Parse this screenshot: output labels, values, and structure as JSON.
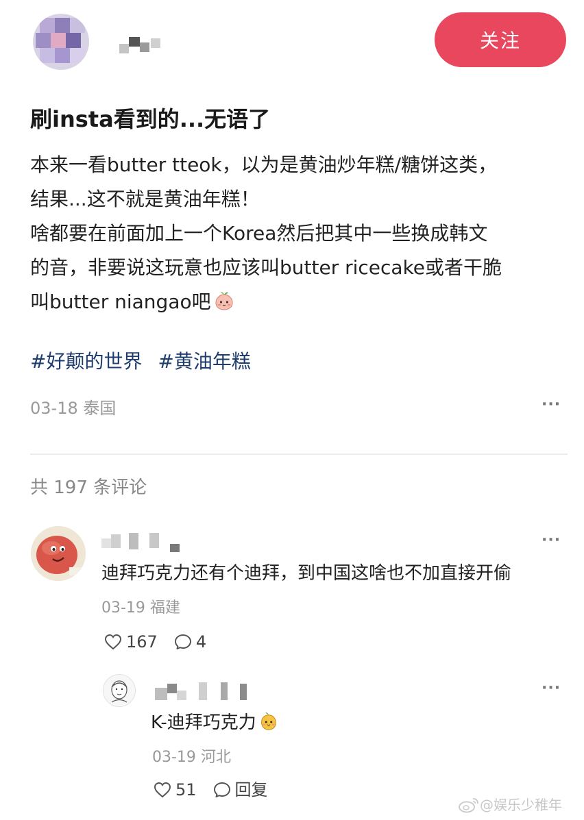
{
  "header": {
    "follow_label": "关注"
  },
  "post": {
    "title": "刷insta看到的...无语了",
    "body_lines": [
      "本来一看butter tteok，以为是黄油炒年糕/糖饼这类，",
      "结果...这不就是黄油年糕！",
      "啥都要在前面加上一个Korea然后把其中一些换成韩文",
      "的音，非要说这玩意也应该叫butter ricecake或者干脆",
      "叫butter niangao吧"
    ],
    "tags": [
      "#好颠的世界",
      "#黄油年糕"
    ],
    "date": "03-18",
    "location": "泰国",
    "more_label": "···"
  },
  "comments": {
    "count_label": "共 197 条评论",
    "items": [
      {
        "text": "迪拜巧克力还有个迪拜，到中国这啥也不加直接开偷",
        "date": "03-19",
        "location": "福建",
        "likes": "167",
        "replies": "4",
        "more_label": "···",
        "reply": {
          "text": "K-迪拜巧克力",
          "date": "03-19",
          "location": "河北",
          "likes": "51",
          "reply_label": "回复",
          "more_label": "···"
        }
      }
    ]
  },
  "watermark": {
    "text": "@娱乐少稚年"
  },
  "colors": {
    "follow_bg": "#e9475e",
    "tag": "#1e3c6e",
    "meta": "#999999"
  }
}
